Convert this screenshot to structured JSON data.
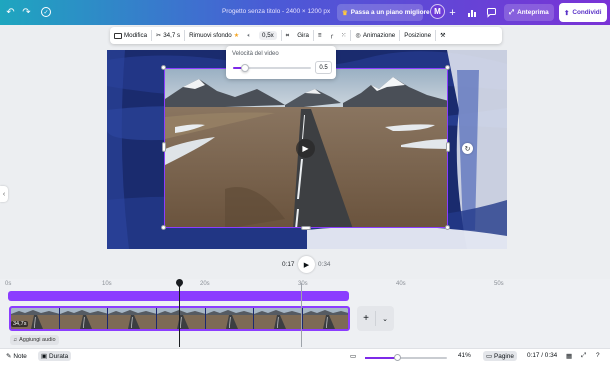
{
  "topbar": {
    "doc_title": "Progetto senza titolo - 2400 × 1200 px",
    "upgrade_label": "Passa a un piano migliore",
    "avatar_initial": "M",
    "preview_label": "Anteprima",
    "share_label": "Condividi"
  },
  "toolbar": {
    "edit_label": "Modifica",
    "duration_label": "34,7 s",
    "remove_bg_label": "Rimuovi sfondo",
    "speed_label": "0,5x",
    "rotate_label": "Gira",
    "animation_label": "Animazione",
    "position_label": "Posizione"
  },
  "speed_popover": {
    "title": "Velocità del video",
    "value": "0.5",
    "level": 0.15
  },
  "playback": {
    "current": "0:17",
    "total": "0:34"
  },
  "timeline": {
    "ticks": [
      "0s",
      "10s",
      "20s",
      "30s",
      "40s",
      "50s"
    ],
    "clip_duration": "34,7s",
    "add_audio_label": "Aggiungi audio",
    "thumbnail_count": 7
  },
  "bottombar": {
    "notes_label": "Note",
    "duration_label": "Durata",
    "zoom_percent": "41%",
    "zoom_level": 0.4,
    "pages_label": "Pagine",
    "page_time": "0:17 / 0:34"
  },
  "colors": {
    "accent": "#8b3dff",
    "topbar_start": "#1ea6bf",
    "topbar_end": "#7a32d6"
  }
}
